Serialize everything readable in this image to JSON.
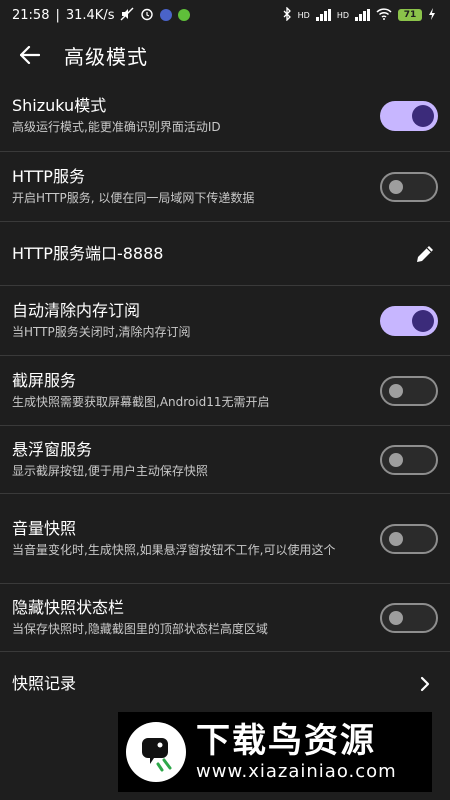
{
  "status_bar": {
    "time": "21:58",
    "net_speed": "31.4K/s",
    "battery": "71",
    "hd_label_1": "HD",
    "hd_label_2": "HD"
  },
  "app_bar": {
    "title": "高级模式"
  },
  "settings": [
    {
      "title": "Shizuku模式",
      "subtitle": "高级运行模式,能更准确识别界面活动ID",
      "control": "toggle",
      "on": true
    },
    {
      "title": "HTTP服务",
      "subtitle": "开启HTTP服务, 以便在同一局域网下传递数据",
      "control": "toggle",
      "on": false
    },
    {
      "title": "HTTP服务端口-8888",
      "subtitle": "",
      "control": "edit"
    },
    {
      "title": "自动清除内存订阅",
      "subtitle": "当HTTP服务关闭时,清除内存订阅",
      "control": "toggle",
      "on": true
    },
    {
      "title": "截屏服务",
      "subtitle": "生成快照需要获取屏幕截图,Android11无需开启",
      "control": "toggle",
      "on": false
    },
    {
      "title": "悬浮窗服务",
      "subtitle": "显示截屏按钮,便于用户主动保存快照",
      "control": "toggle",
      "on": false
    },
    {
      "title": "音量快照",
      "subtitle": "当音量变化时,生成快照,如果悬浮窗按钮不工作,可以使用这个",
      "control": "toggle",
      "on": false
    },
    {
      "title": "隐藏快照状态栏",
      "subtitle": "当保存快照时,隐藏截图里的顶部状态栏高度区域",
      "control": "toggle",
      "on": false
    },
    {
      "title": "快照记录",
      "subtitle": "",
      "control": "chevron"
    }
  ],
  "watermark": {
    "title": "下载鸟资源",
    "url": "www.xiazainiao.com"
  },
  "colors": {
    "background": "#1e1e1e",
    "toggle_on_track": "#c7b6ff",
    "toggle_on_knob": "#3b2b7a",
    "divider": "#3a3a3a"
  }
}
